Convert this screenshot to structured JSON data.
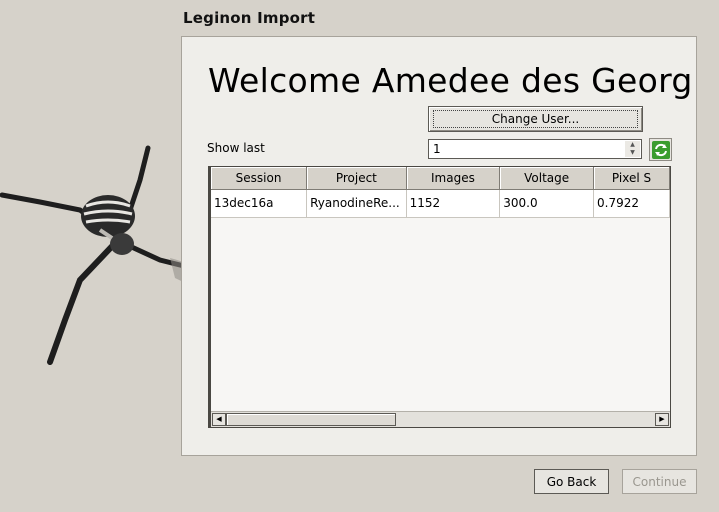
{
  "window": {
    "title": "Leginon Import"
  },
  "welcome": {
    "text": "Welcome Amedee des Georg"
  },
  "user": {
    "change_label": "Change User..."
  },
  "show_last": {
    "label": "Show last",
    "value": "1"
  },
  "table": {
    "columns": [
      "Session",
      "Project",
      "Images",
      "Voltage",
      "Pixel S"
    ],
    "rows": [
      [
        "13dec16a",
        "RyanodineRe...",
        "1152",
        "300.0",
        "0.7922"
      ]
    ]
  },
  "footer": {
    "back_label": "Go Back",
    "continue_label": "Continue"
  },
  "icons": {
    "refresh": "refresh-icon",
    "decor": "spider-icon"
  },
  "colors": {
    "background": "#d6d2ca",
    "panel": "#efeeea",
    "refresh": "#3a9c2e"
  }
}
